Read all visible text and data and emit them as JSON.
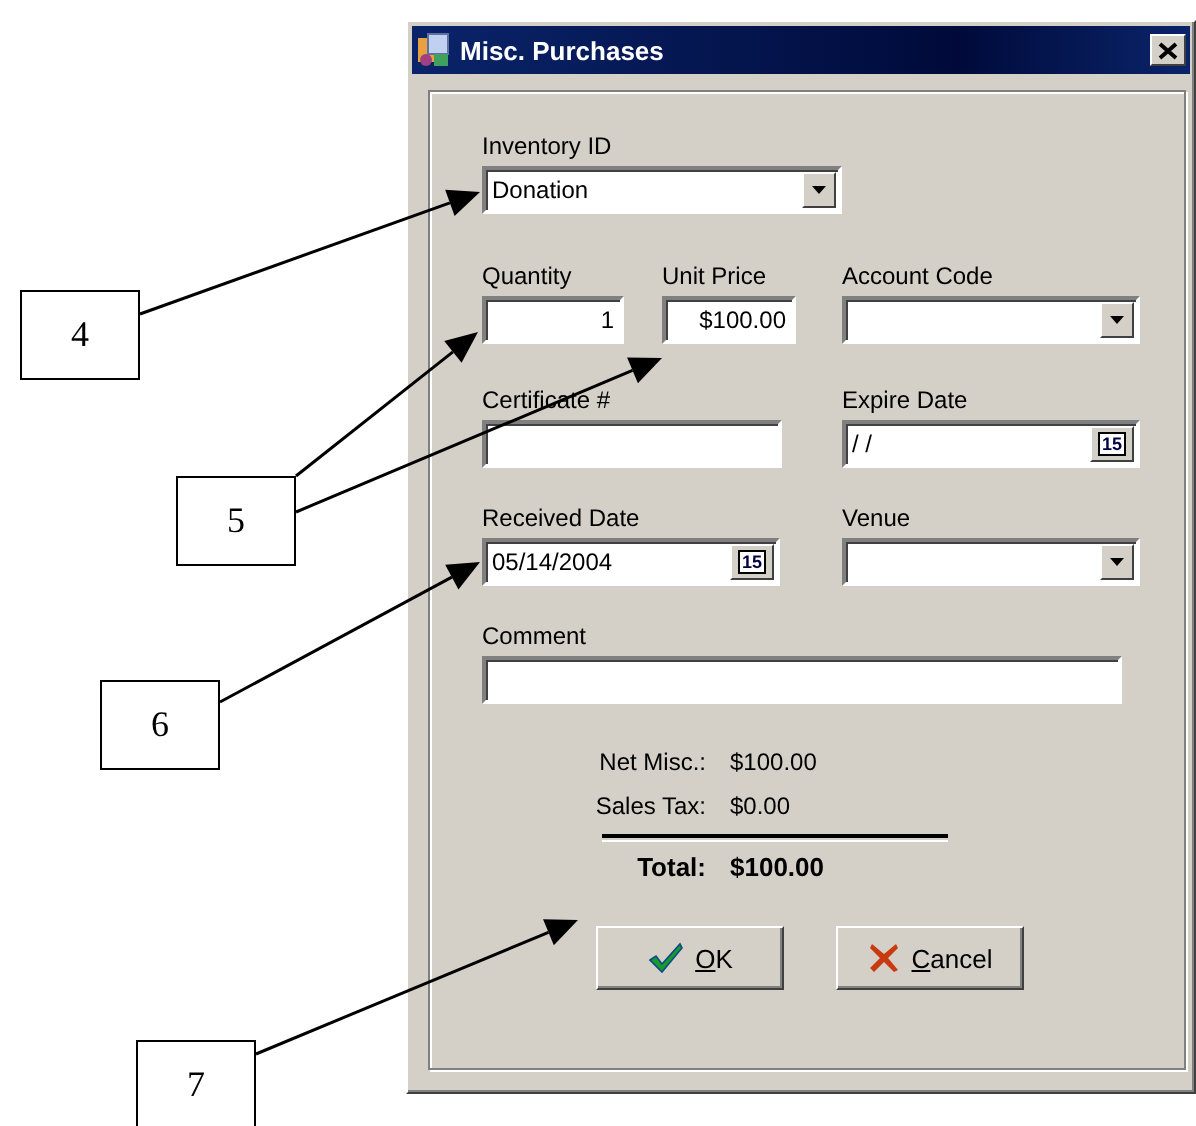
{
  "window": {
    "title": "Misc. Purchases"
  },
  "rows": [
    [
      {
        "label": "Inventory ID",
        "kind": "combo",
        "value": "Donation"
      }
    ],
    [
      {
        "label": "Quantity",
        "kind": "number",
        "value": "1"
      },
      {
        "label": "Unit Price",
        "kind": "number",
        "value": "$100.00"
      },
      {
        "label": "Account Code",
        "kind": "combo"
      }
    ],
    [
      {
        "label": "Certificate #",
        "kind": "text"
      },
      {
        "label": "Expire Date",
        "kind": "date",
        "value": "/ /",
        "button_text": "15"
      }
    ],
    [
      {
        "label": "Received Date",
        "kind": "date",
        "value": "05/14/2004",
        "button_text": "15"
      },
      {
        "label": "Venue",
        "kind": "combo"
      }
    ],
    [
      {
        "label": "Comment",
        "kind": "text"
      }
    ]
  ],
  "summary": [
    {
      "label": "Net Misc.:",
      "value": "$100.00",
      "kind": "line"
    },
    {
      "label": "Sales Tax:",
      "value": "$0.00",
      "kind": "line"
    },
    {
      "label": "Total:",
      "value": "$100.00",
      "kind": "total"
    }
  ],
  "buttons": [
    {
      "label": "OK",
      "kind": "ok"
    },
    {
      "label": "Cancel",
      "kind": "cancel"
    }
  ],
  "callouts": [
    {
      "label": "4"
    },
    {
      "label": "5"
    },
    {
      "label": "6"
    },
    {
      "label": "7"
    }
  ]
}
